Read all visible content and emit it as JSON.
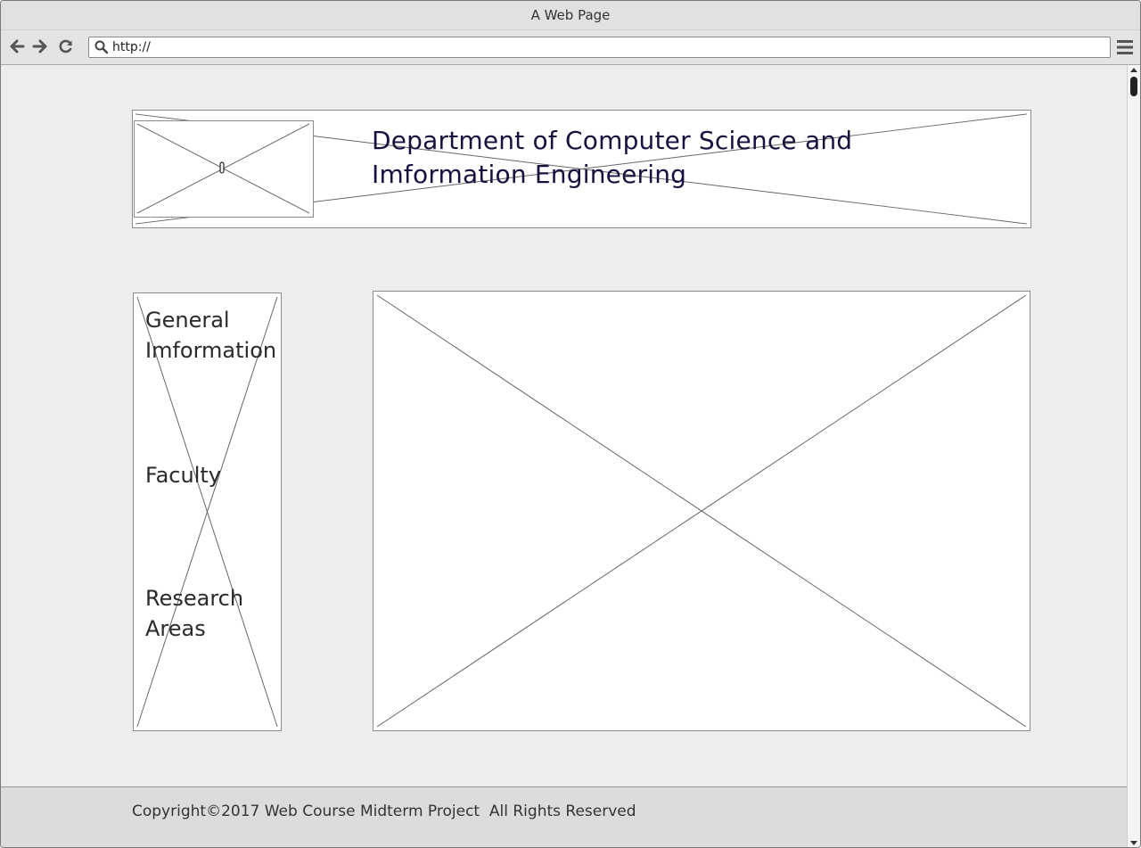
{
  "window": {
    "title": "A Web Page"
  },
  "toolbar": {
    "back_icon": "arrow-left-icon",
    "forward_icon": "arrow-right-icon",
    "reload_icon": "reload-icon",
    "search_icon": "search-icon",
    "url_value": "http://",
    "menu_icon": "hamburger-menu-icon"
  },
  "header": {
    "title": "Department of Computer Science and Imformation Engineering"
  },
  "sidebar": {
    "items": [
      {
        "label": "General Imformation"
      },
      {
        "label": "Faculty"
      },
      {
        "label": "Research Areas"
      }
    ]
  },
  "footer": {
    "text": "Copyright©2017 Web Course Midterm Project  All Rights Reserved"
  }
}
